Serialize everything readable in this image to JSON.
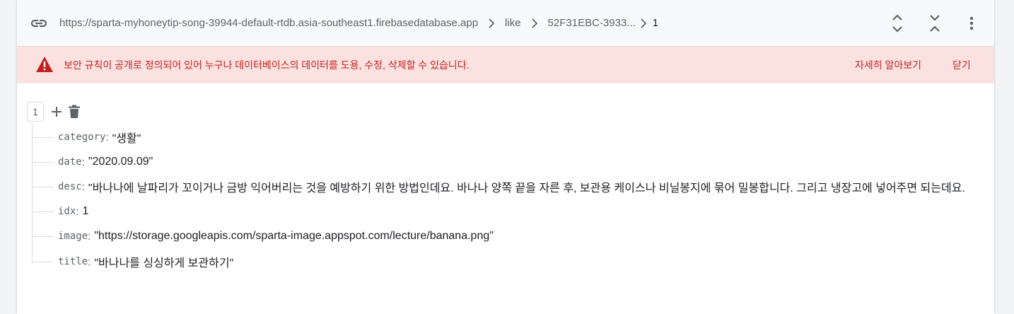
{
  "urlbar": {
    "path": [
      "https://sparta-myhoneytip-song-39944-default-rtdb.asia-southeast1.firebasedatabase.app",
      "like",
      "52F31EBC-3933...",
      "1"
    ]
  },
  "banner": {
    "message": "보안 규칙이 공개로 정의되어 있어 누구나 데이터베이스의 데이터를 도용, 수정, 삭제할 수 있습니다.",
    "learn_more": "자세히 알아보기",
    "close": "닫기"
  },
  "node": {
    "key": "1",
    "children": [
      {
        "key": "category",
        "value": "\"생활\""
      },
      {
        "key": "date",
        "value": "\"2020.09.09\""
      },
      {
        "key": "desc",
        "value": "\"바나나에 날파리가 꼬이거나 금방 익어버리는 것을 예방하기 위한 방법인데요. 바나나 양쪽 끝을 자른 후, 보관용 케이스나 비닐봉지에 묶어 밀봉합니다. 그리고 냉장고에 넣어주면 되는데요."
      },
      {
        "key": "idx",
        "value": "1"
      },
      {
        "key": "image",
        "value": "\"https://storage.googleapis.com/sparta-image.appspot.com/lecture/banana.png\""
      },
      {
        "key": "title",
        "value": "\"바나나를 싱싱하게 보관하기\""
      }
    ]
  },
  "colors": {
    "banner_bg": "#fbe2e1",
    "banner_text": "#c5221f",
    "warning_icon": "#c5221f",
    "urlbar_bg": "#f8f9fa"
  },
  "icons": {
    "link": "link-icon",
    "expand": "expand-all-icon",
    "collapse": "collapse-all-icon",
    "more": "more-vert-icon",
    "warning": "warning-icon",
    "add": "add-icon",
    "delete": "trash-icon"
  }
}
